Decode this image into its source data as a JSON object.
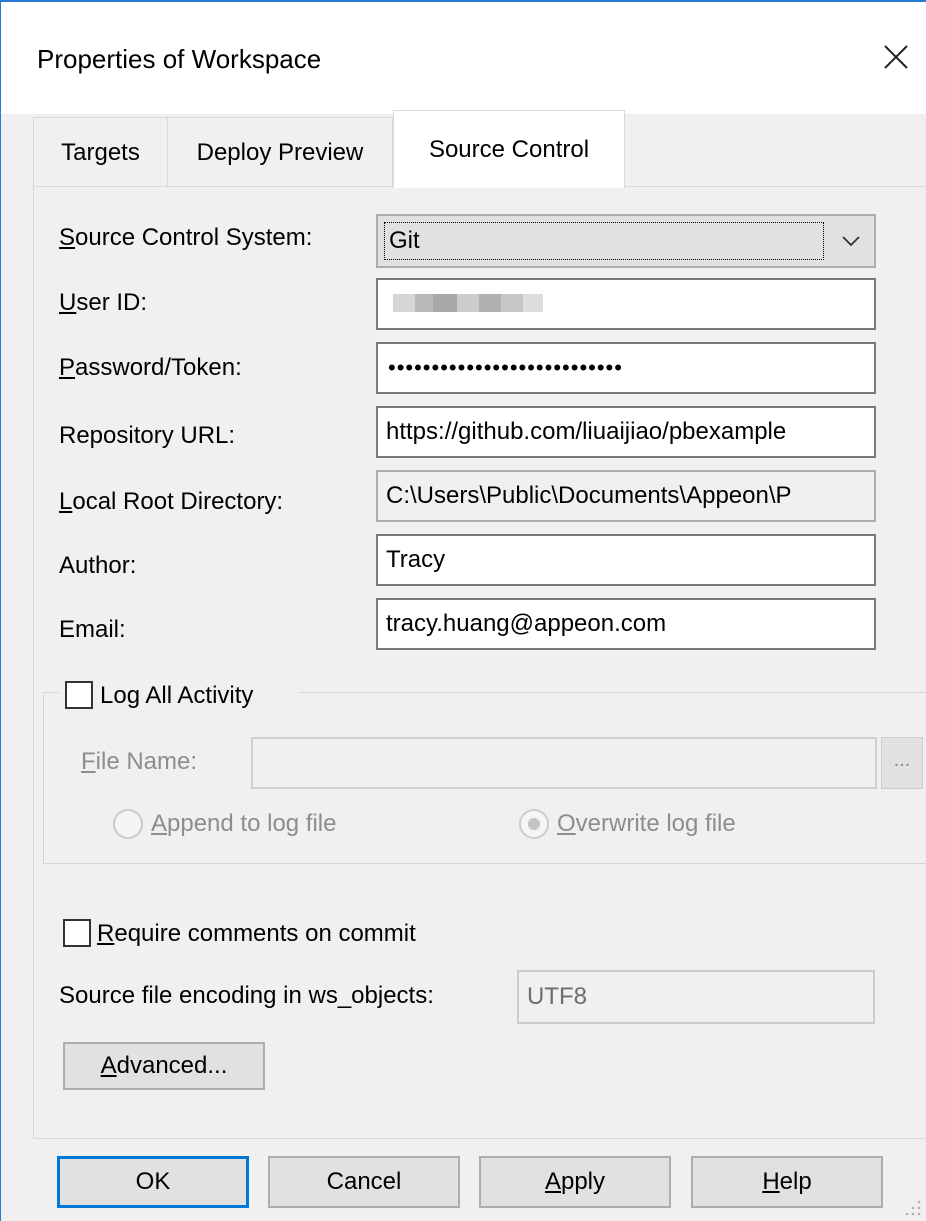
{
  "window": {
    "title": "Properties of Workspace",
    "close_icon": "close-icon"
  },
  "tabs": [
    {
      "label": "Targets",
      "active": false
    },
    {
      "label": "Deploy Preview",
      "active": false
    },
    {
      "label": "Source Control",
      "active": true
    }
  ],
  "form": {
    "scs_label_u": "S",
    "scs_label_rest": "ource Control System:",
    "scs_value": "Git",
    "userid_label_u": "U",
    "userid_label_rest": "ser ID:",
    "userid_value_note": "blurred",
    "password_label_u": "P",
    "password_label_rest": "assword/Token:",
    "password_value": "•••••••••••••••••••••••••••",
    "repo_label": "Repository URL:",
    "repo_value": "https://github.com/liuaijiao/pbexample",
    "localroot_label_u": "L",
    "localroot_label_rest": "ocal Root Directory:",
    "localroot_value": "C:\\Users\\Public\\Documents\\Appeon\\P",
    "author_label": "Author:",
    "author_value": "Tracy",
    "email_label": "Email:",
    "email_value": "tracy.huang@appeon.com"
  },
  "log": {
    "checkbox_label_pre": "Lo",
    "checkbox_label_u": "g",
    "checkbox_label_post": " All Activity",
    "checked": false,
    "filename_label_u": "F",
    "filename_label_rest": "ile Name:",
    "filename_value": "",
    "browse_label": "...",
    "append_label_u": "A",
    "append_label_rest": "ppend to log file",
    "overwrite_label_u": "O",
    "overwrite_label_rest": "verwrite log file",
    "selected": "overwrite"
  },
  "commit": {
    "require_label_u": "R",
    "require_label_rest": "equire comments on commit",
    "checked": false,
    "encoding_label": "Source file encoding in ws_objects:",
    "encoding_value": "UTF8"
  },
  "advanced_label_u": "A",
  "advanced_label_rest": "dvanced...",
  "buttons": {
    "ok": "OK",
    "cancel": "Cancel",
    "apply_u": "A",
    "apply_rest": "pply",
    "help_u": "H",
    "help_rest": "elp"
  },
  "colors": {
    "accent": "#0078d7",
    "title_border": "#2b79d6",
    "dialog_bg": "#f0f0f0"
  }
}
